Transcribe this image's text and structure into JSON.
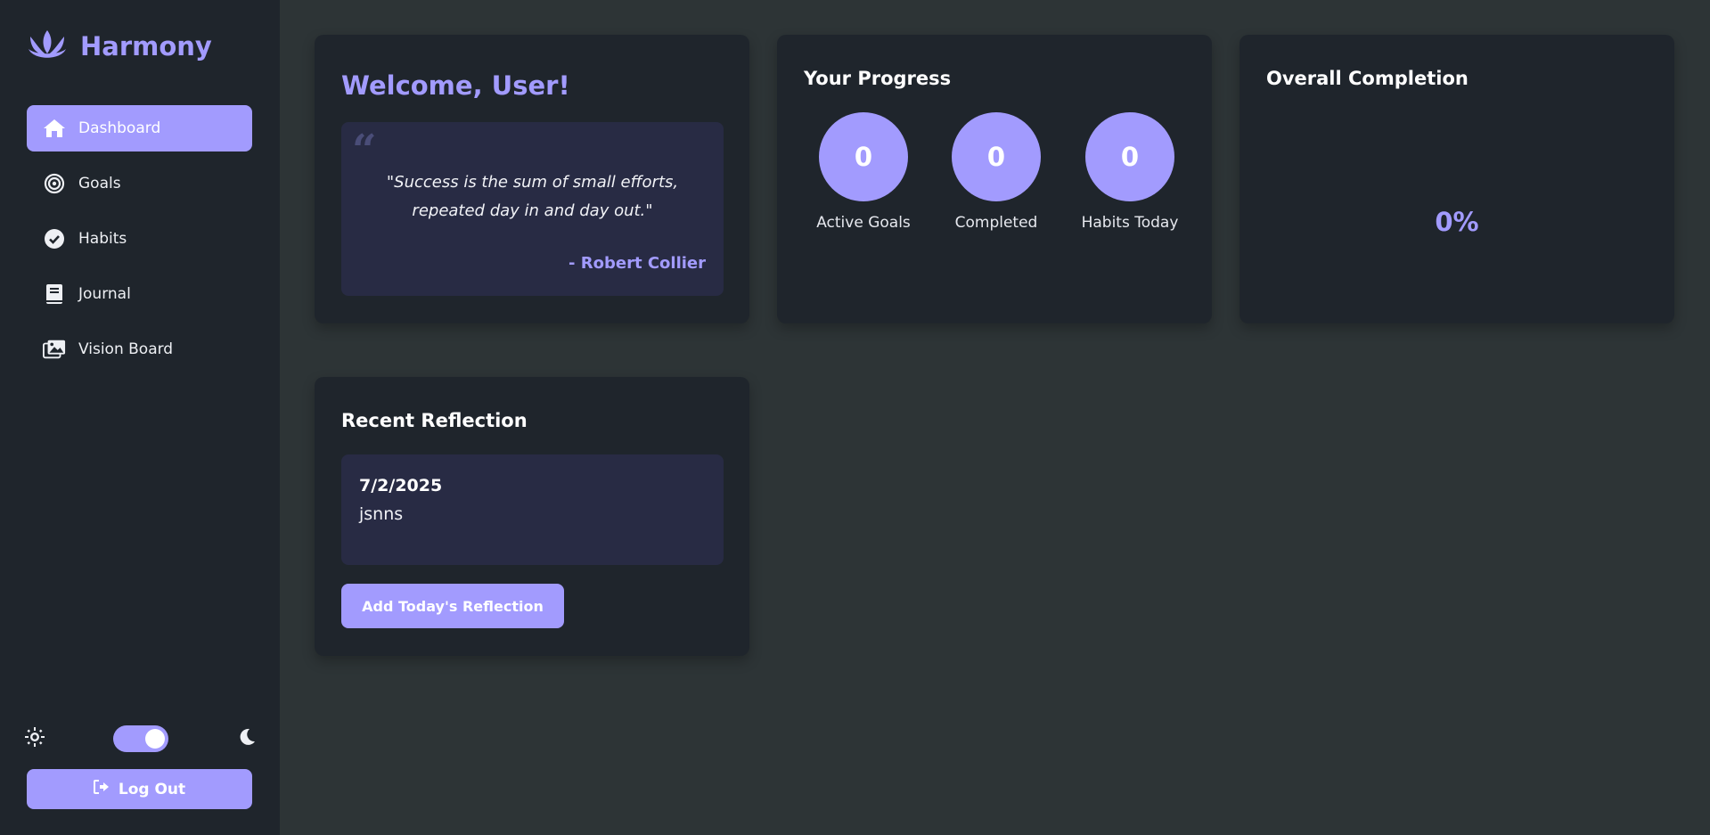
{
  "app": {
    "name": "Harmony",
    "accent_color": "#a29bfe",
    "logo_icon": "lotus-icon"
  },
  "sidebar": {
    "items": [
      {
        "label": "Dashboard",
        "icon": "home-icon",
        "active": true
      },
      {
        "label": "Goals",
        "icon": "target-icon",
        "active": false
      },
      {
        "label": "Habits",
        "icon": "check-circle-icon",
        "active": false
      },
      {
        "label": "Journal",
        "icon": "book-icon",
        "active": false
      },
      {
        "label": "Vision Board",
        "icon": "images-icon",
        "active": false
      }
    ],
    "theme_toggle": {
      "light_icon": "sun-icon",
      "dark_icon": "moon-icon",
      "dark_mode": true
    },
    "logout_label": "Log Out"
  },
  "welcome": {
    "title": "Welcome, User!",
    "quote": "\"Success is the sum of small efforts, repeated day in and day out.\"",
    "author": "- Robert Collier"
  },
  "progress": {
    "title": "Your Progress",
    "stats": [
      {
        "value": "0",
        "label": "Active Goals"
      },
      {
        "value": "0",
        "label": "Completed"
      },
      {
        "value": "0",
        "label": "Habits Today"
      }
    ]
  },
  "overall": {
    "title": "Overall Completion",
    "value": "0%"
  },
  "reflection": {
    "title": "Recent Reflection",
    "date": "7/2/2025",
    "text": "jsnns",
    "add_label": "Add Today's Reflection"
  }
}
